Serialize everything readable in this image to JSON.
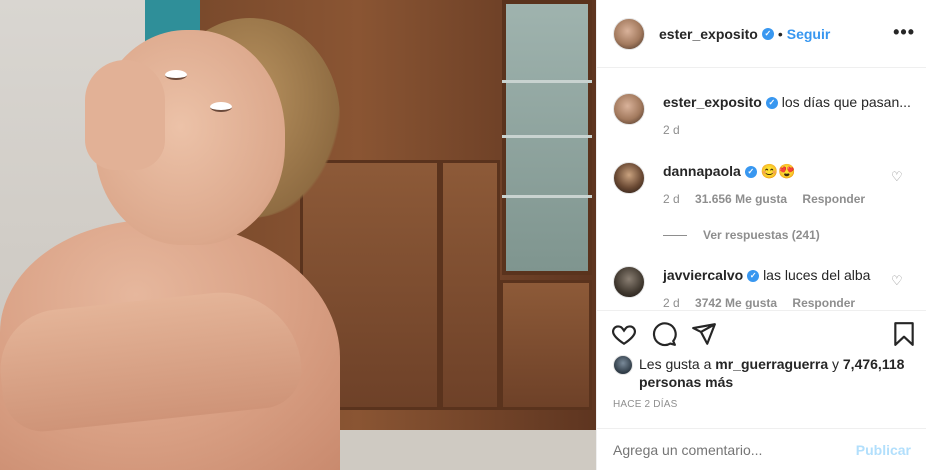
{
  "post": {
    "author": "ester_exposito",
    "follow_label": "Seguir",
    "separator": "•",
    "more_label": "•••"
  },
  "caption": {
    "username": "ester_exposito",
    "text": "los días que pasan...",
    "time": "2 d"
  },
  "comments": [
    {
      "username": "dannapaola",
      "text": "😊😍",
      "time": "2 d",
      "likes": "31.656 Me gusta",
      "reply_label": "Responder"
    },
    {
      "username": "javviercalvo",
      "text": "las luces del alba",
      "time": "2 d",
      "likes": "3742 Me gusta",
      "reply_label": "Responder"
    }
  ],
  "view_replies": "Ver respuestas (241)",
  "likes": {
    "prefix": "Les gusta a",
    "user": "mr_guerraguerra",
    "and": "y",
    "count": "7,476,118 personas más"
  },
  "timestamp": "HACE 2 DÍAS",
  "add_comment": {
    "placeholder": "Agrega un comentario...",
    "publish_label": "Publicar"
  },
  "colors": {
    "link": "#3897f0",
    "muted": "#8e8e8e",
    "publish_disabled": "#b2dffc"
  }
}
